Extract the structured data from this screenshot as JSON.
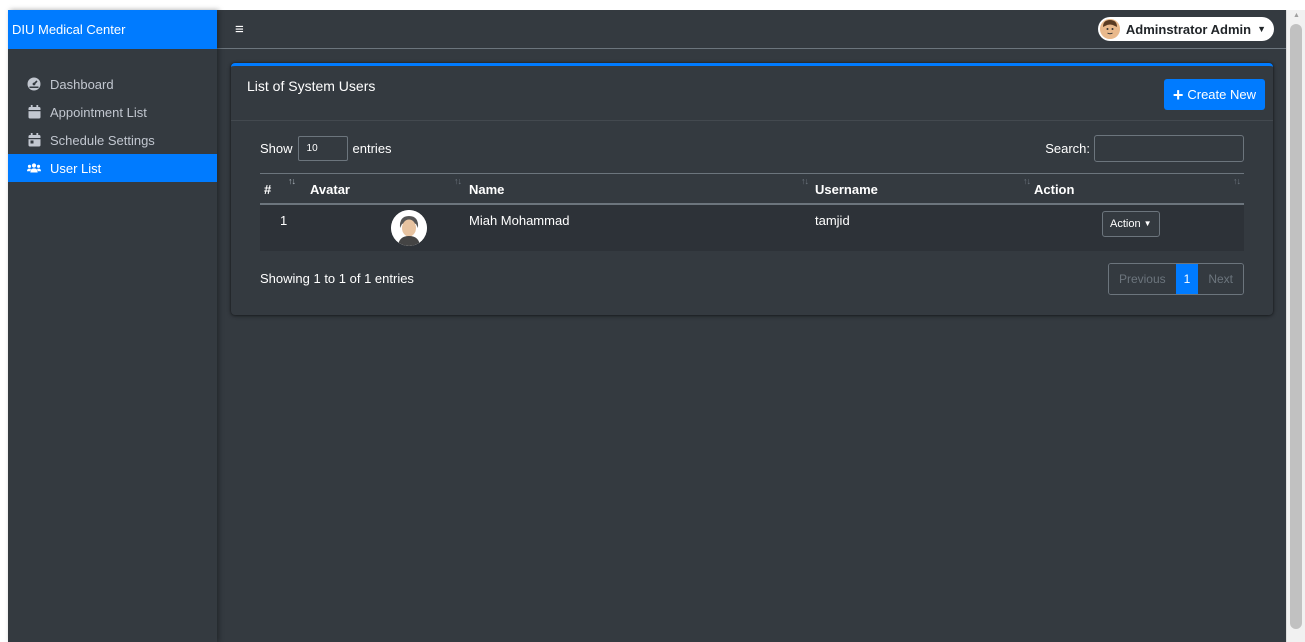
{
  "sidebar": {
    "brand": "DIU Medical Center",
    "items": [
      {
        "label": "Dashboard",
        "icon": "dashboard-icon"
      },
      {
        "label": "Appointment List",
        "icon": "calendar-icon"
      },
      {
        "label": "Schedule Settings",
        "icon": "calendar-day-icon"
      },
      {
        "label": "User List",
        "icon": "users-icon",
        "active": true
      }
    ]
  },
  "topbar": {
    "menu_icon": "hamburger-icon",
    "user_name": "Adminstrator Admin"
  },
  "card": {
    "title": "List of System Users",
    "create_button": "Create New"
  },
  "datatable": {
    "show_label": "Show",
    "length_value": "10",
    "entries_label": "entries",
    "search_label": "Search:",
    "search_value": "",
    "columns": [
      "#",
      "Avatar",
      "Name",
      "Username",
      "Action"
    ],
    "rows": [
      {
        "num": "1",
        "name": "Miah Mohammad",
        "username": "tamjid",
        "action": "Action"
      }
    ],
    "info": "Showing 1 to 1 of 1 entries",
    "pagination": {
      "previous": "Previous",
      "current": "1",
      "next": "Next"
    }
  },
  "colors": {
    "accent": "#007bff",
    "background": "#343a40"
  }
}
